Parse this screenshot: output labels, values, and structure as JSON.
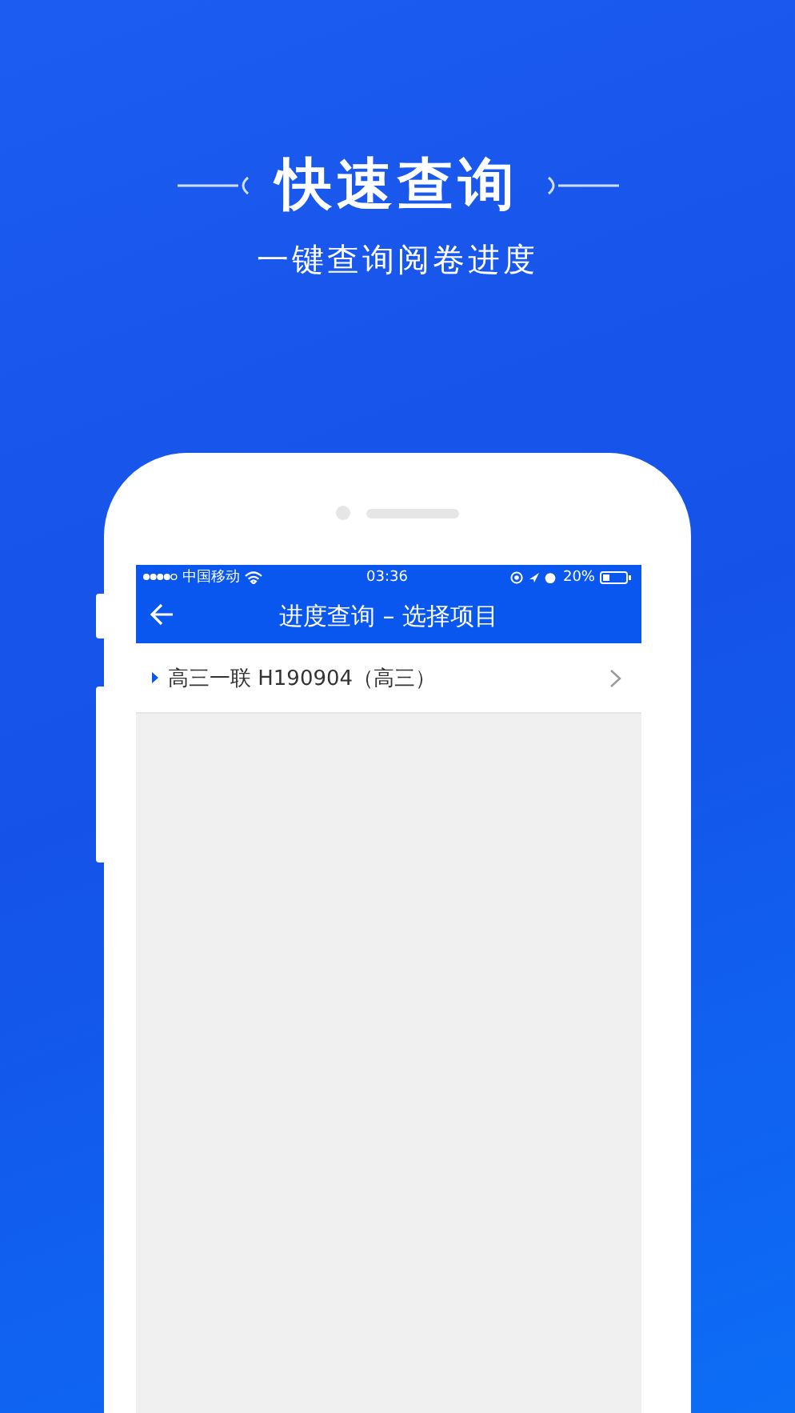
{
  "headline": "快速查询",
  "subtitle": "一键查询阅卷进度",
  "status_bar": {
    "carrier": "中国移动",
    "time": "03:36",
    "battery": "20%"
  },
  "nav": {
    "title": "进度查询 – 选择项目"
  },
  "items": [
    {
      "label": "高三一联 H190904（高三）"
    }
  ]
}
